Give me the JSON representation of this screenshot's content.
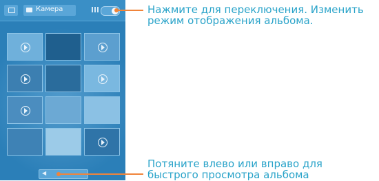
{
  "topbar": {
    "album_label": "Камера"
  },
  "thumbnails": [
    {
      "kind": "video",
      "color": "#6fb0db"
    },
    {
      "kind": "photo",
      "color": "#1f5f8e"
    },
    {
      "kind": "video",
      "color": "#5c9fcf"
    },
    {
      "kind": "video",
      "color": "#3c7fb1"
    },
    {
      "kind": "photo",
      "color": "#2a6c9c"
    },
    {
      "kind": "video",
      "color": "#7ab8e0"
    },
    {
      "kind": "video",
      "color": "#4b8dbf"
    },
    {
      "kind": "photo",
      "color": "#6ca9d4"
    },
    {
      "kind": "photo",
      "color": "#8bc1e4"
    },
    {
      "kind": "photo",
      "color": "#3e82b5"
    },
    {
      "kind": "photo",
      "color": "#9ccbe8"
    },
    {
      "kind": "video",
      "color": "#2f74a8"
    }
  ],
  "callouts": {
    "toggle_text_line1": "Нажмите для переключения. Изменить",
    "toggle_text_line2": "режим отображения альбома.",
    "scrub_text_line1": "Потяните влево или вправо для",
    "scrub_text_line2": "быстрого просмотра альбома"
  },
  "colors": {
    "accent": "#f0843a",
    "caption": "#29a3c9",
    "screen": "#2b7fb8"
  }
}
